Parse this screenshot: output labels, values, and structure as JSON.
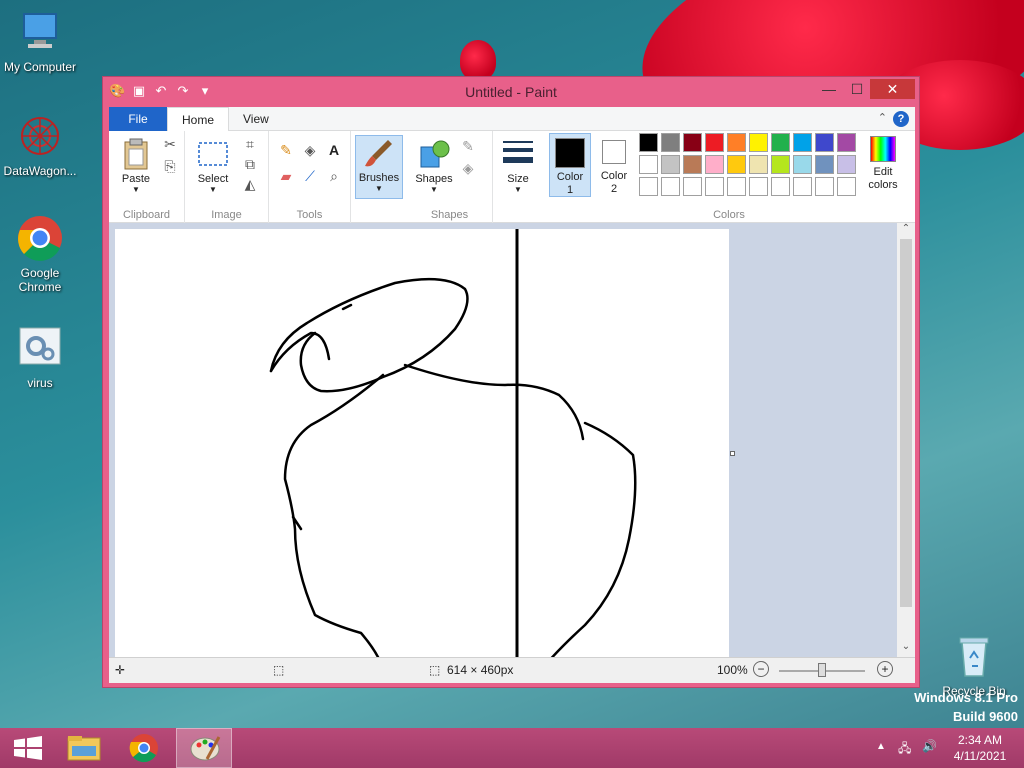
{
  "desktop": {
    "icons": [
      {
        "label": "My Computer",
        "icon": "computer-icon"
      },
      {
        "label": "DataWagon...",
        "icon": "datawagon-icon"
      },
      {
        "label": "Google Chrome",
        "icon": "chrome-icon"
      },
      {
        "label": "virus",
        "icon": "settings-file-icon"
      },
      {
        "label": "Recycle Bin",
        "icon": "recycle-bin-icon"
      }
    ],
    "watermark_line1": "Windows 8.1 Pro",
    "watermark_line2": "Build 9600"
  },
  "window": {
    "title": "Untitled - Paint",
    "controls": {
      "minimize": "—",
      "maximize": "☐",
      "close": "✕"
    }
  },
  "ribbon": {
    "tabs": [
      "File",
      "Home",
      "View"
    ],
    "active_tab": "Home",
    "groups": {
      "clipboard": {
        "label": "Clipboard",
        "paste": "Paste"
      },
      "image": {
        "label": "Image",
        "select": "Select"
      },
      "tools": {
        "label": "Tools"
      },
      "brushes": {
        "label": "Brushes"
      },
      "shapes": {
        "label": "Shapes",
        "button": "Shapes"
      },
      "size": {
        "label": "Size"
      },
      "colors": {
        "label": "Colors",
        "color1": "Color 1",
        "color2": "Color 2",
        "edit": "Edit colors",
        "color1_value": "#000000",
        "color2_value": "#ffffff",
        "palette_row1": [
          "#000000",
          "#7f7f7f",
          "#880015",
          "#ed1c24",
          "#ff7f27",
          "#fff200",
          "#22b14c",
          "#00a2e8",
          "#3f48cc",
          "#a349a4"
        ],
        "palette_row2": [
          "#ffffff",
          "#c3c3c3",
          "#b97a57",
          "#ffaec9",
          "#ffc90e",
          "#efe4b0",
          "#b5e61d",
          "#99d9ea",
          "#7092be",
          "#c8bfe7"
        ],
        "palette_row3": [
          "#ffffff",
          "#ffffff",
          "#ffffff",
          "#ffffff",
          "#ffffff",
          "#ffffff",
          "#ffffff",
          "#ffffff",
          "#ffffff",
          "#ffffff"
        ]
      }
    }
  },
  "status": {
    "canvas_size": "614 × 460px",
    "zoom": "100%"
  },
  "taskbar": {
    "time": "2:34 AM",
    "date": "4/11/2021"
  }
}
